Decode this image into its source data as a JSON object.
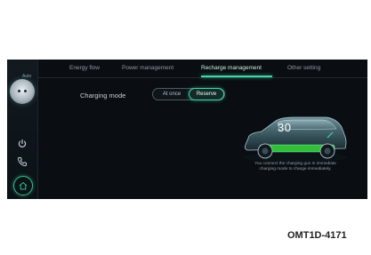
{
  "sidebar": {
    "avatar_label": "Auto"
  },
  "tabs": [
    {
      "label": "Energy flow",
      "active": false
    },
    {
      "label": "Power management",
      "active": false
    },
    {
      "label": "Recharge management",
      "active": true
    },
    {
      "label": "Other setting",
      "active": false
    }
  ],
  "charging_mode": {
    "label": "Charging mode",
    "options": [
      "At once",
      "Reserve"
    ],
    "selected": "Reserve"
  },
  "vehicle": {
    "soc_value": "30",
    "info_text": "You connect the charging gun in immediate charging mode to charge immediately."
  },
  "caption": "OMT1D-4171",
  "colors": {
    "accent": "#3fd6a8",
    "battery": "#2fbf3a",
    "screen_bg": "#0a0e12"
  },
  "icons": [
    "power-icon",
    "phone-icon",
    "home-icon"
  ]
}
